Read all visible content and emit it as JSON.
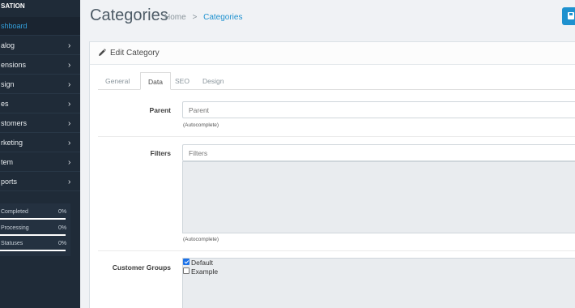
{
  "sidebar": {
    "heading": "SATION",
    "items": [
      {
        "label": "shboard",
        "active": true
      },
      {
        "label": "alog"
      },
      {
        "label": "ensions"
      },
      {
        "label": "sign"
      },
      {
        "label": "es"
      },
      {
        "label": "stomers"
      },
      {
        "label": "rketing"
      },
      {
        "label": "tem"
      },
      {
        "label": "ports"
      }
    ],
    "chevron": "›",
    "stats": [
      {
        "label": "Completed",
        "value": "0%"
      },
      {
        "label": "Processing",
        "value": "0%"
      },
      {
        "label": "Statuses",
        "value": "0%"
      }
    ]
  },
  "header": {
    "title": "Categories",
    "breadcrumb": {
      "home": "Home",
      "separator": ">",
      "current": "Categories"
    }
  },
  "panel": {
    "title": "Edit Category",
    "tabs": [
      "General",
      "Data",
      "SEO",
      "Design"
    ],
    "active_tab": "Data"
  },
  "form": {
    "parent": {
      "label": "Parent",
      "placeholder": "Parent",
      "help": "(Autocomplete)"
    },
    "filters": {
      "label": "Filters",
      "placeholder": "Filters",
      "help": "(Autocomplete)"
    },
    "customer_groups": {
      "label": "Customer Groups",
      "options": [
        {
          "label": "Default",
          "checked": true
        },
        {
          "label": "Example",
          "checked": false
        }
      ]
    }
  },
  "colors": {
    "sidebar_bg": "#1f2b38",
    "accent": "#1e91cf",
    "active_nav": "#33a1dd"
  },
  "icons": [
    "chevron-right-icon",
    "save-icon",
    "pencil-icon",
    "checkbox-icon"
  ]
}
